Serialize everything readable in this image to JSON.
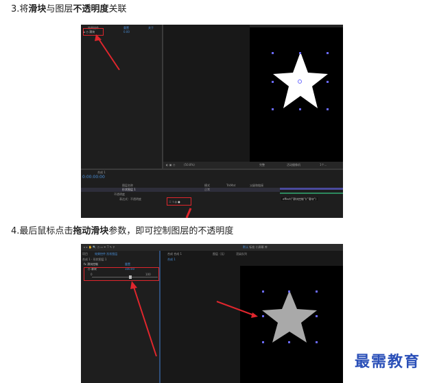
{
  "steps": [
    {
      "prefix": "3.将",
      "bold1": "滑块",
      "mid1": "与图层",
      "bold2": "不透明度",
      "suffix": "关联"
    },
    {
      "prefix": "4.最后鼠标点击",
      "bold1": "拖动滑块",
      "mid1": "参数，即可控制图层的不透明度"
    }
  ],
  "shot1": {
    "left_panel": {
      "col_headers": [
        "效果控件",
        "重置",
        "关于"
      ],
      "layer_label": "滑块",
      "layer_value": "0.00"
    },
    "timeline": {
      "tab_label": "合成 1",
      "timecode": "0:00:00:00",
      "layer_name": "形状图层 1",
      "prop_label": "不透明度",
      "expr_label": "表达式：不透明度",
      "mode_label": "正常",
      "col_headers": [
        "图层名称",
        "模式",
        "TrkMat",
        "父级和链接"
      ],
      "expr_text": "effect(\"滑块控制\")(\"滑块\")"
    },
    "viewer": {
      "zoom_label": "(50.8%)",
      "view_label": "完整",
      "cam_label": "活动摄像机",
      "views_label": "1个..."
    }
  },
  "shot2": {
    "left_panel": {
      "tabs": [
        "项目",
        "效果控件 形状图层"
      ],
      "layer_label": "合成 1 · 形状图层 1",
      "fx_label": "滑块控制",
      "fx_reset": "重置",
      "slider_label": "滑块",
      "slider_value": "100.00",
      "slider_min": "0",
      "slider_max": "100"
    },
    "viewer": {
      "tab_label": "合成 合成 1",
      "layer_tab": "图层（无）",
      "flow_tab": "渲染队列",
      "breadcrumb": "合成 1"
    },
    "toolbar": {
      "items": [
        "默认",
        "标准",
        "小屏幕",
        "库"
      ]
    }
  },
  "watermark": "最需教育",
  "colors": {
    "red": "#e0262d",
    "accent_blue": "#4a8fd8",
    "star_white": "#ffffff",
    "star_grey": "#a9a9a9",
    "panel_bg": "#232323"
  }
}
